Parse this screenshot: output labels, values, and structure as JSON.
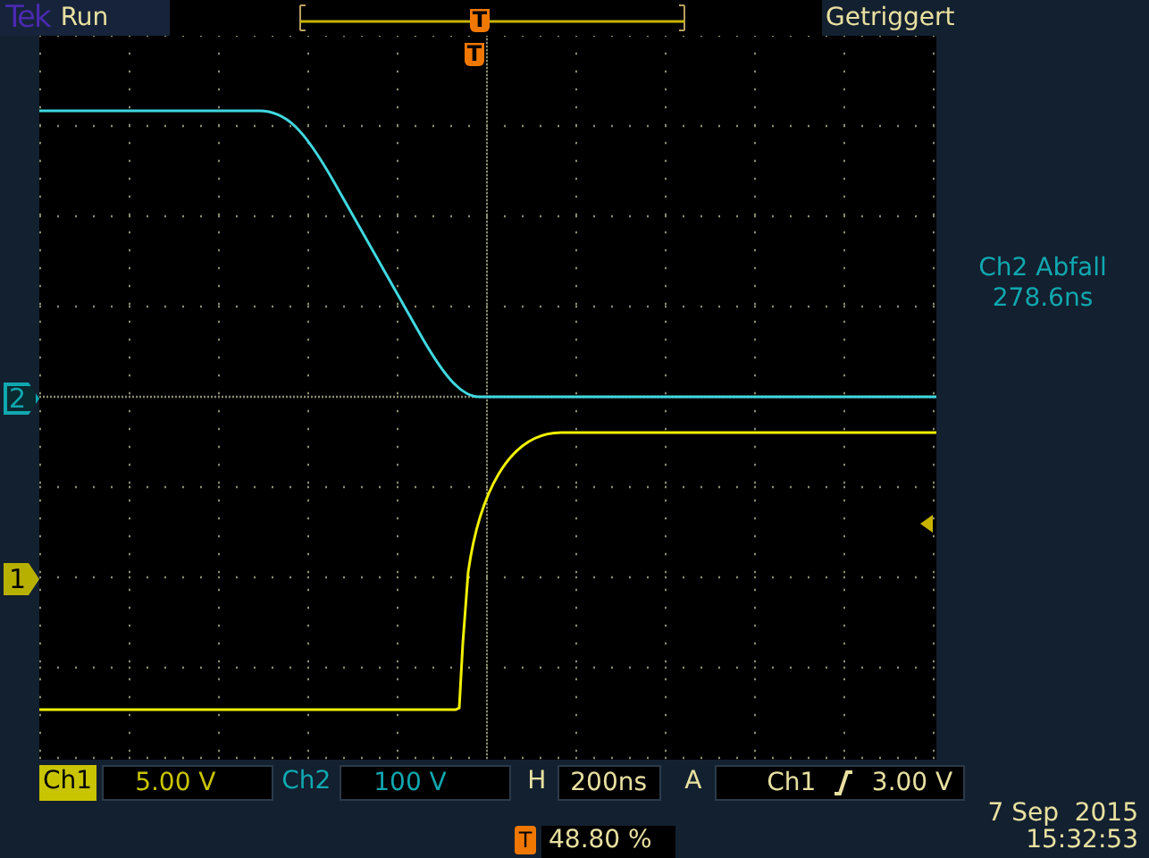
{
  "header": {
    "brand": "Tek",
    "state": "Run",
    "trigger_marker": "T",
    "trigger_status": "Getriggert"
  },
  "screen": {
    "trigger_marker": "T"
  },
  "channel_markers": [
    {
      "label": "2",
      "color": "#10a8b0",
      "selected": false
    },
    {
      "label": "1",
      "color": "#b8b000",
      "selected": true
    }
  ],
  "measurement": {
    "title": "Ch2 Abfall",
    "value": "278.6ns"
  },
  "readouts": [
    {
      "kind": "channel",
      "label": "Ch1",
      "value": "5.00 V",
      "color": "#c8c400",
      "selected": true
    },
    {
      "kind": "channel",
      "label": "Ch2",
      "value": "100 V",
      "color": "#10a8b0",
      "selected": false
    },
    {
      "kind": "horizontal",
      "label": "H",
      "value": "200ns"
    },
    {
      "kind": "trigger",
      "label": "A",
      "source": "Ch1",
      "value": "3.00 V"
    }
  ],
  "trigger_position": {
    "badge": "T",
    "value": "48.80 %"
  },
  "date": "7 Sep  2015",
  "time": "15:32:53"
}
